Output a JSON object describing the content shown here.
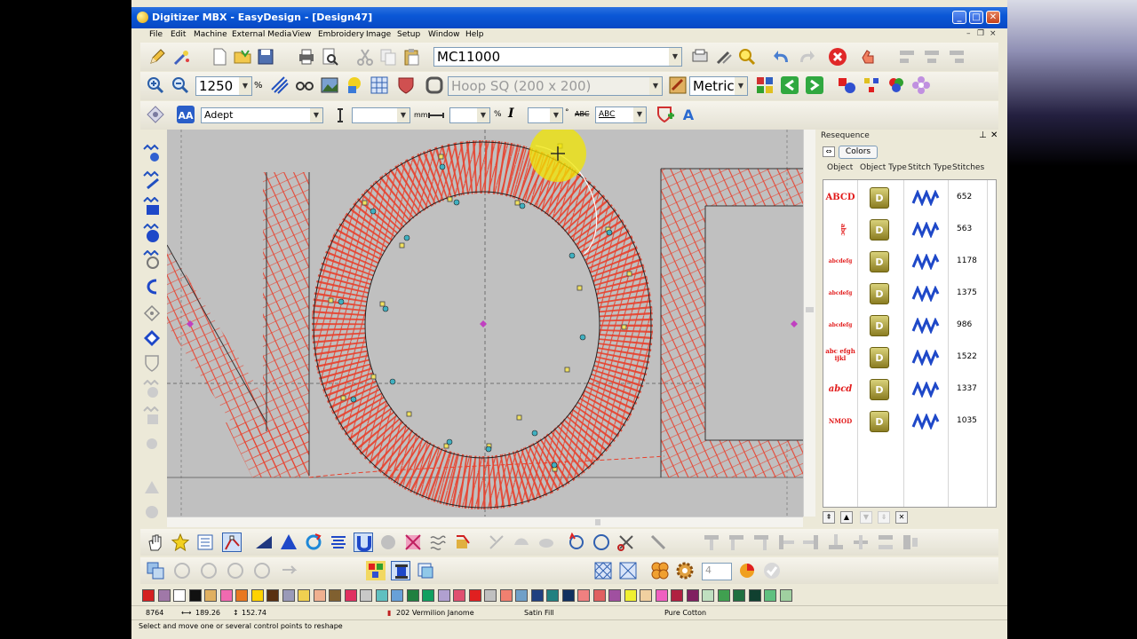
{
  "window": {
    "title": "Digitizer MBX - EasyDesign - [Design47]",
    "min_symbol": "_",
    "max_symbol": "□",
    "close_symbol": "✕"
  },
  "menu": {
    "items": [
      "File",
      "Edit",
      "Machine",
      "External Media",
      "View",
      "Embroidery",
      "Image",
      "Setup",
      "Window",
      "Help"
    ],
    "mdi_controls": [
      "–",
      "❐",
      "×"
    ]
  },
  "toolbar1": {
    "machine_value": "MC11000",
    "icons": [
      "pencil-icon",
      "magic-wand-icon",
      "new-file-icon",
      "open-folder-icon",
      "save-icon",
      "print-icon",
      "print-preview-icon",
      "cut-icon",
      "copy-icon",
      "paste-icon",
      "stitch-out-icon",
      "wand-icon",
      "find-icon",
      "undo-icon",
      "redo-icon",
      "stop-icon",
      "hand-cursor-icon",
      "align-icon"
    ]
  },
  "toolbar2": {
    "zoom_value": "1250",
    "zoom_unit": "%",
    "hoop_value": "Hoop SQ (200 x 200)",
    "units_value": "Metric"
  },
  "toolbar3": {
    "font_value": "Adept",
    "height_unit": "mm",
    "width_unit": "%",
    "angle_unit": "°",
    "italic_label": "I",
    "abc_label_1": "ABC",
    "abc_label_2": "ABC"
  },
  "resequence": {
    "title": "Resequence",
    "colors_button": "Colors",
    "columns": [
      "Object",
      "Object Type",
      "Stitch Type",
      "Stitches"
    ],
    "rows": [
      {
        "thumb": "ABCD",
        "type_glyph": "D",
        "stitches": "652"
      },
      {
        "thumb": "abc",
        "type_glyph": "D",
        "stitches": "563"
      },
      {
        "thumb": "abcdefg",
        "type_glyph": "D",
        "stitches": "1178"
      },
      {
        "thumb": "abcdefg",
        "type_glyph": "D",
        "stitches": "1375"
      },
      {
        "thumb": "abcdefg",
        "type_glyph": "D",
        "stitches": "986"
      },
      {
        "thumb": "abc efgh ijkl",
        "type_glyph": "D",
        "stitches": "1522"
      },
      {
        "thumb": "abcd",
        "type_glyph": "D",
        "stitches": "1337"
      },
      {
        "thumb": "NMOD",
        "type_glyph": "D",
        "stitches": "1035"
      }
    ]
  },
  "palette": {
    "colors": [
      "#d42020",
      "#a078a8",
      "#ffffff",
      "#111111",
      "#e0b060",
      "#f06ab0",
      "#e87820",
      "#ffd200",
      "#5a3010",
      "#9a9ab8",
      "#f0d050",
      "#f0b090",
      "#806030",
      "#e03060",
      "#c8c8c8",
      "#60c0c0",
      "#68a0d8",
      "#208040",
      "#10a060",
      "#b0a0d0",
      "#e05070",
      "#e02020",
      "#c0c0c0",
      "#f08070",
      "#70a0c8",
      "#204080",
      "#208080",
      "#103060",
      "#f08080",
      "#e06060",
      "#a050a0",
      "#f0f030",
      "#f0d0a0",
      "#f060c0",
      "#b02040",
      "#802060",
      "#c0e0c0",
      "#40a050",
      "#207040",
      "#104030",
      "#60c080",
      "#a0d0a0"
    ]
  },
  "status": {
    "stitch_count": "8764",
    "width": "189.26",
    "height": "152.74",
    "thread": "202 Vermilion Janome",
    "fill": "Satin Fill",
    "fabric": "Pure Cotton",
    "hint": "Select and move one or several control points to reshape"
  },
  "bottom_toolbar": {
    "spin_value": "4"
  }
}
